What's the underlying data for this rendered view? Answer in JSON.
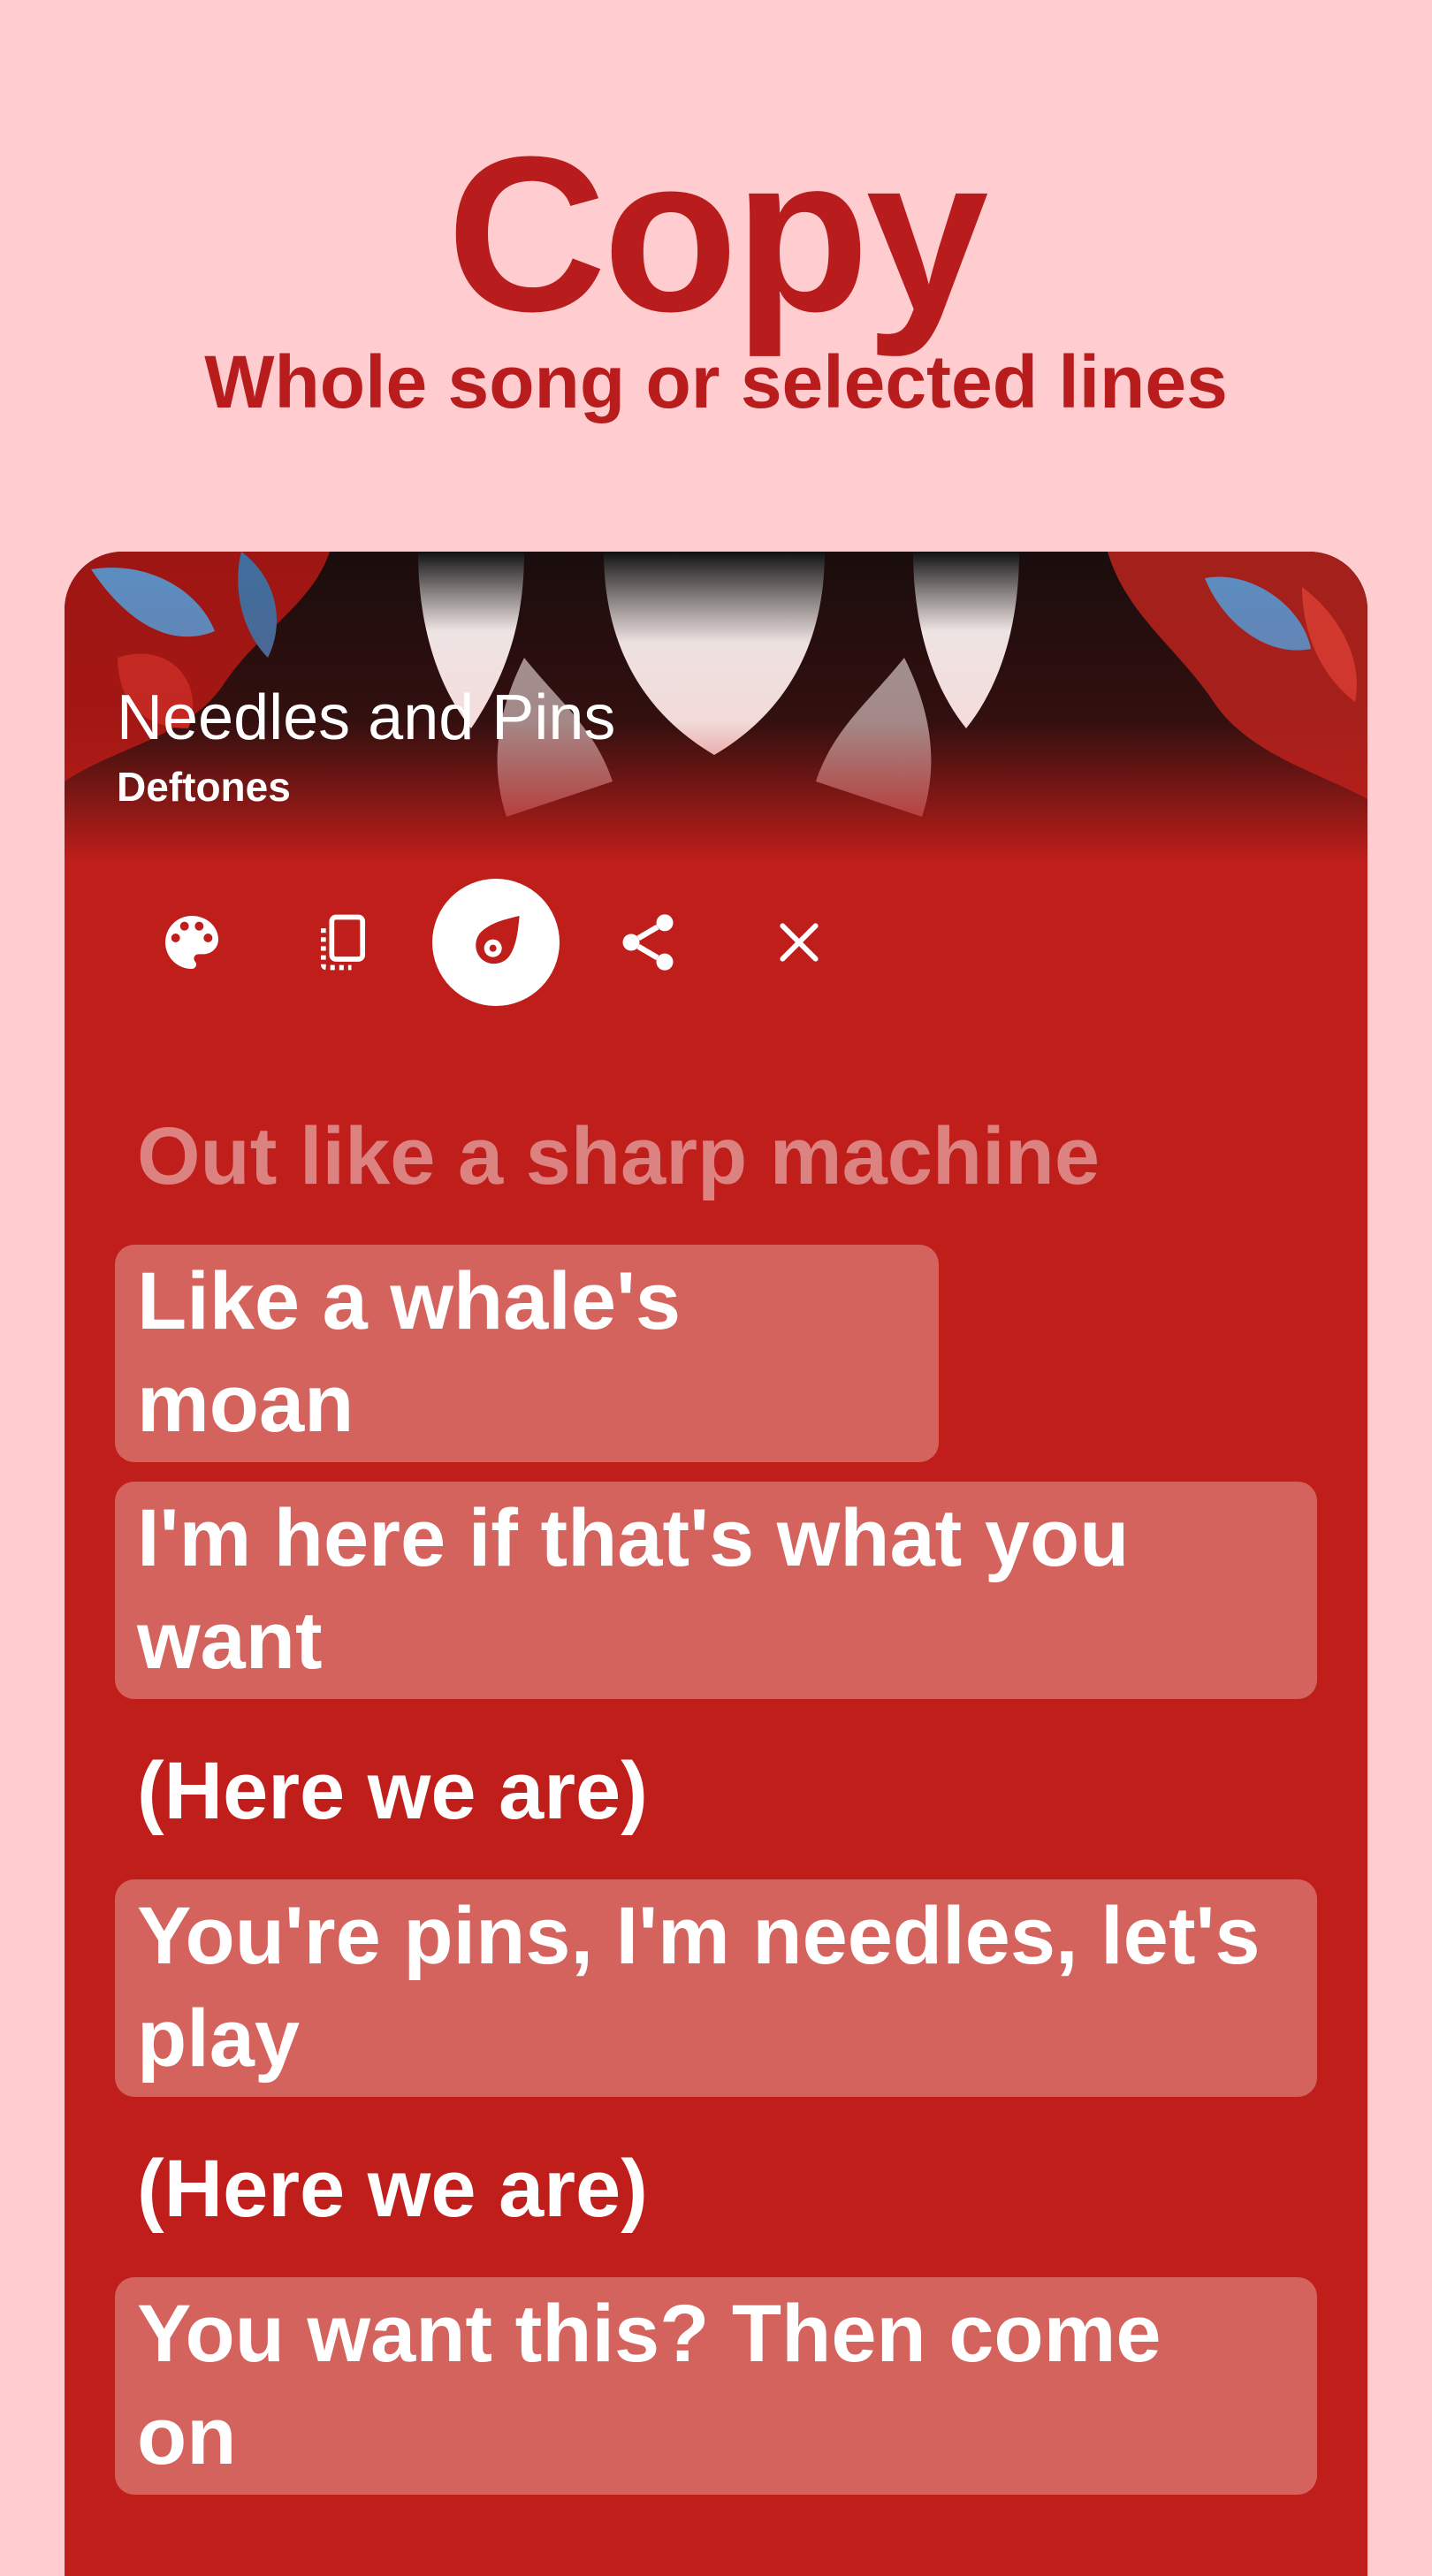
{
  "promo": {
    "title": "Copy",
    "subtitle": "Whole song or selected lines"
  },
  "song": {
    "title": "Needles and Pins",
    "artist": "Deftones"
  },
  "toolbar": {
    "icons": [
      "palette-icon",
      "copy-icon",
      "sticker-icon",
      "share-icon",
      "close-icon"
    ],
    "active": "sticker-icon"
  },
  "lyrics": {
    "lines": [
      {
        "text": "Out like a sharp machine",
        "selected": false,
        "faded": true
      },
      {
        "text": "Like a whale's moan",
        "selected": true,
        "faded": false
      },
      {
        "text": "I'm here if that's what you want",
        "selected": true,
        "faded": false
      },
      {
        "text": "(Here we are)",
        "selected": false,
        "faded": false
      },
      {
        "text": "You're pins, I'm needles, let's play",
        "selected": true,
        "faded": false
      },
      {
        "text": "(Here we are)",
        "selected": false,
        "faded": false
      },
      {
        "text": "You want this? Then come on",
        "selected": true,
        "faded": false
      }
    ]
  },
  "colors": {
    "background": "#ffcdd0",
    "accent": "#b91c1c",
    "card": "#bf1e1a",
    "selection": "#d4625d"
  }
}
